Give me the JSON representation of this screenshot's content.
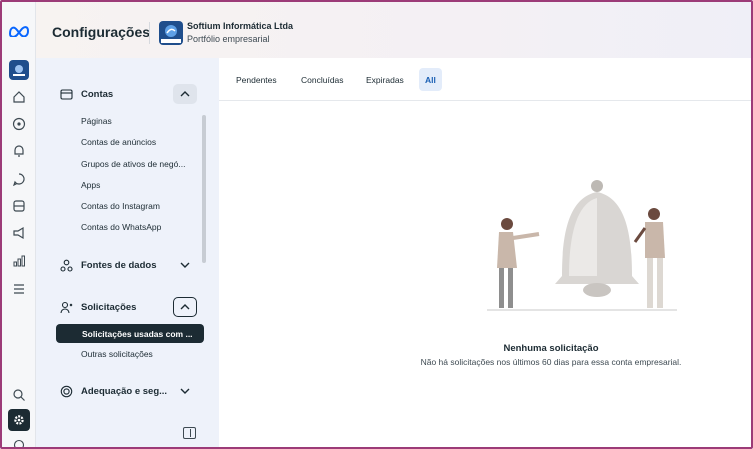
{
  "header": {
    "title": "Configurações",
    "business_name": "Softium Informática Ltda",
    "business_subtitle": "Portfólio empresarial"
  },
  "rail": {
    "icons": [
      "meta-logo-icon",
      "business-avatar-icon",
      "home-icon",
      "compass-icon",
      "bell-icon",
      "chat-icon",
      "inbox-icon",
      "megaphone-icon",
      "chart-icon",
      "menu-icon",
      "search-icon",
      "gear-icon",
      "help-icon"
    ]
  },
  "sidebar": {
    "sections": [
      {
        "label": "Contas",
        "expanded": true,
        "items": [
          "Páginas",
          "Contas de anúncios",
          "Grupos de ativos de negó...",
          "Apps",
          "Contas do Instagram",
          "Contas do WhatsApp"
        ]
      },
      {
        "label": "Fontes de dados",
        "expanded": false
      },
      {
        "label": "Solicitações",
        "expanded": true,
        "items": [
          "Solicitações usadas com ...",
          "Outras solicitações"
        ],
        "active_item": "Solicitações usadas com ..."
      },
      {
        "label": "Adequação e seg...",
        "expanded": false
      }
    ]
  },
  "main": {
    "tabs": [
      "Pendentes",
      "Concluídas",
      "Expiradas",
      "All"
    ],
    "active_tab": "All",
    "empty_title": "Nenhuma solicitação",
    "empty_subtitle": "Não há solicitações nos últimos 60 dias para essa conta empresarial."
  },
  "colors": {
    "frame_border": "#9c3b78",
    "sidebar_bg": "#eef2fa",
    "active_item_bg": "#1c2b33",
    "active_tab_bg": "#e3ecfa",
    "active_tab_text": "#1a5fb4"
  }
}
